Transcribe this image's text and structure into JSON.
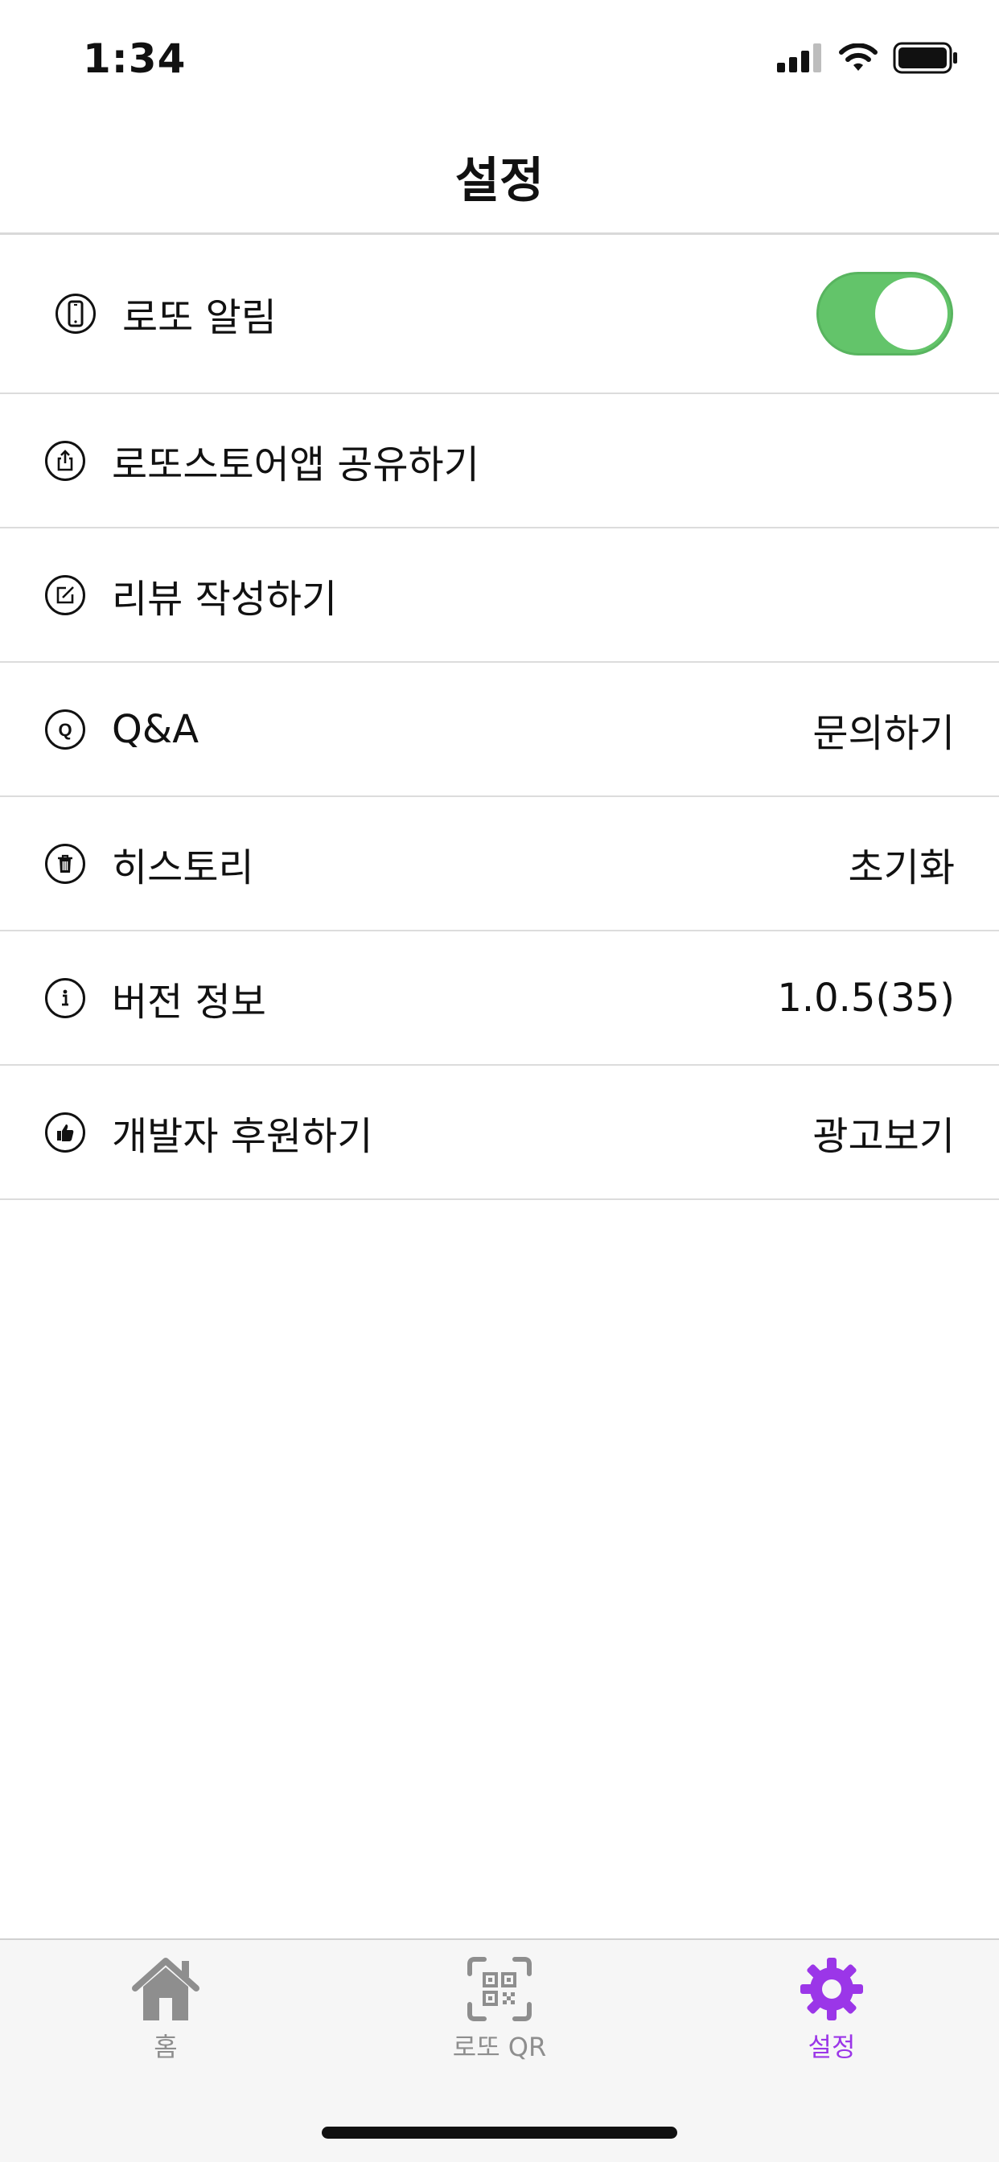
{
  "status_bar": {
    "time": "1:34"
  },
  "nav": {
    "title": "설정"
  },
  "rows": [
    {
      "icon": "phone-icon",
      "label": "로또 알림",
      "toggle_on": true
    },
    {
      "icon": "share-icon",
      "label": "로또스토어앱 공유하기",
      "value": ""
    },
    {
      "icon": "edit-icon",
      "label": "리뷰 작성하기",
      "value": ""
    },
    {
      "icon": "q-icon",
      "label": "Q&A",
      "value": "문의하기"
    },
    {
      "icon": "trash-icon",
      "label": "히스토리",
      "value": "초기화"
    },
    {
      "icon": "info-icon",
      "label": "버전 정보",
      "value": "1.0.5(35)"
    },
    {
      "icon": "thumbs-up-icon",
      "label": "개발자 후원하기",
      "value": "광고보기"
    }
  ],
  "tabs": [
    {
      "icon": "home-icon",
      "label": "홈",
      "active": false
    },
    {
      "icon": "qr-scan-icon",
      "label": "로또 QR",
      "active": false
    },
    {
      "icon": "gear-icon",
      "label": "설정",
      "active": true
    }
  ],
  "colors": {
    "accent": "#9b36e8",
    "toggle_on": "#63c46a",
    "inactive": "#8e8e8e"
  }
}
